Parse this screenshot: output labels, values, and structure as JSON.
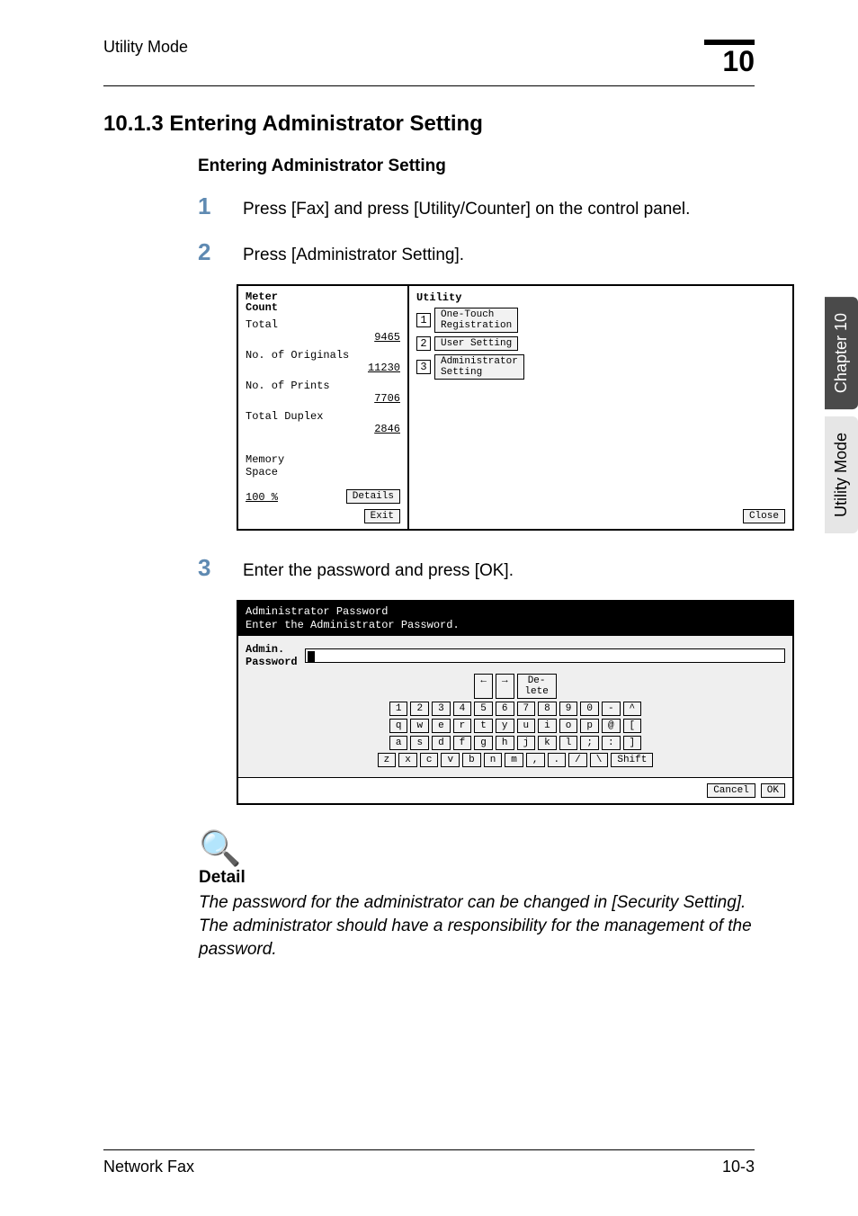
{
  "header": {
    "running_title": "Utility Mode",
    "chapter_number": "10"
  },
  "section": {
    "number_title": "10.1.3  Entering Administrator Setting",
    "sub_title": "Entering Administrator Setting"
  },
  "steps": [
    {
      "num": "1",
      "text": "Press [Fax] and press [Utility/Counter] on the control panel."
    },
    {
      "num": "2",
      "text": "Press [Administrator Setting]."
    },
    {
      "num": "3",
      "text": "Enter the password and press [OK]."
    }
  ],
  "panel_utility": {
    "meter_label": "Meter\nCount",
    "rows": [
      {
        "label": "Total",
        "value": "9465"
      },
      {
        "label": "No. of Originals",
        "value": "11230"
      },
      {
        "label": "No. of Prints",
        "value": "7706"
      },
      {
        "label": "Total Duplex",
        "value": "2846"
      }
    ],
    "memory_label": "Memory\nSpace",
    "memory_value": "100 %",
    "details_btn": "Details",
    "exit_btn": "Exit",
    "utility_title": "Utility",
    "options": [
      {
        "idx": "1",
        "label": "One-Touch\nRegistration"
      },
      {
        "idx": "2",
        "label": "User Setting"
      },
      {
        "idx": "3",
        "label": "Administrator\nSetting"
      }
    ],
    "close_btn": "Close"
  },
  "panel_kbd": {
    "hdr_line1": "Administrator Password",
    "hdr_line2": "Enter the Administrator Password.",
    "pw_label": "Admin.\nPassword",
    "arrow_left": "←",
    "arrow_right": "→",
    "delete_btn": "De-\nlete",
    "row_num": [
      "1",
      "2",
      "3",
      "4",
      "5",
      "6",
      "7",
      "8",
      "9",
      "0",
      "-",
      "^"
    ],
    "row_q": [
      "q",
      "w",
      "e",
      "r",
      "t",
      "y",
      "u",
      "i",
      "o",
      "p",
      "@",
      "["
    ],
    "row_a": [
      "a",
      "s",
      "d",
      "f",
      "g",
      "h",
      "j",
      "k",
      "l",
      ";",
      ":",
      "]"
    ],
    "row_z": [
      "z",
      "x",
      "c",
      "v",
      "b",
      "n",
      "m",
      ",",
      ".",
      "/",
      "\\"
    ],
    "shift_btn": "Shift",
    "cancel_btn": "Cancel",
    "ok_btn": "OK"
  },
  "detail": {
    "head": "Detail",
    "body": "The password for the administrator can be changed in [Security Setting]. The administrator should have a responsibility for the management of the password."
  },
  "sidetab": {
    "dark": "Chapter 10",
    "light": "Utility Mode"
  },
  "footer": {
    "left": "Network Fax",
    "right": "10-3"
  }
}
